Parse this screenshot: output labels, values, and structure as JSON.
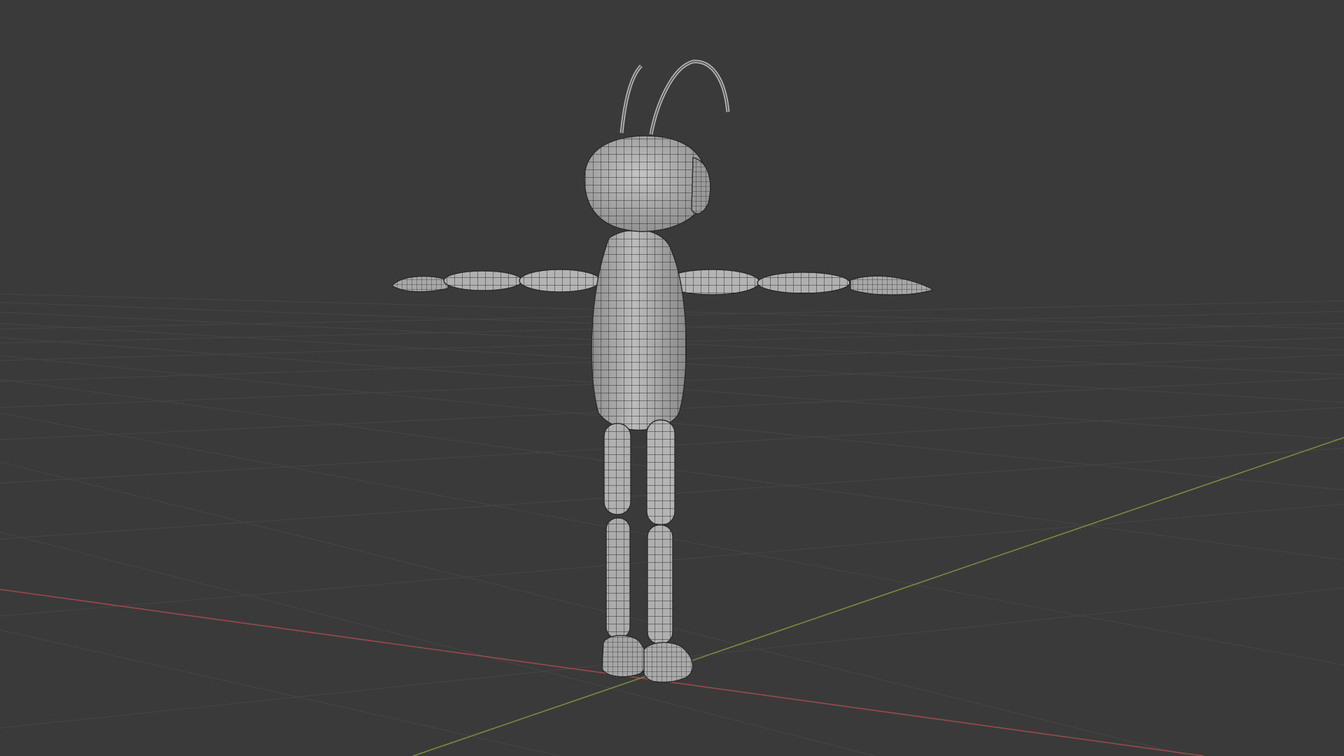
{
  "app": {
    "view": "3d-viewport",
    "shading": "solid-wireframe-overlay"
  },
  "colors": {
    "background": "#3a3a3a",
    "grid_line": "#4a4a4a",
    "x_axis": "#9a4a4c",
    "y_axis": "#7a8c3c",
    "mesh_fill": "#9e9e9e",
    "mesh_light": "#bdbdbd",
    "mesh_wire": "#2a2a2a"
  },
  "scene": {
    "object": "ant-character-tpose",
    "axes": [
      "x-axis-line",
      "y-axis-line"
    ]
  }
}
